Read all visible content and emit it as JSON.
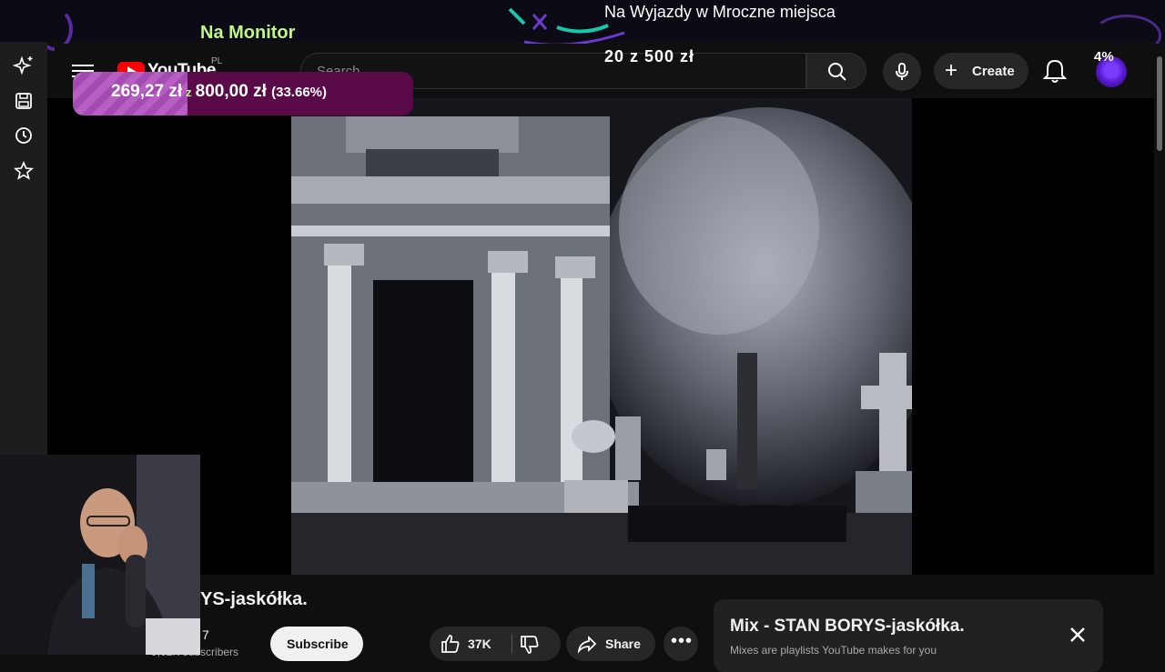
{
  "overlay": {
    "title": "Na Monitor",
    "goal_title": "Na Wyjazdy w Mroczne miejsca",
    "goal_amount": "20 z 500 zł",
    "goal_percent": "4%",
    "goal_fraction": 0.04
  },
  "donation": {
    "current": "269,27 zł",
    "separator": "z",
    "target": "800,00 zł",
    "percent": "(33.66%)",
    "progress": 0.3366,
    "fill_color": "#b85fc4",
    "track_color": "#5a0a48"
  },
  "header": {
    "logo_word": "YouTube",
    "country": "PL",
    "search_placeholder": "Search",
    "create_label": "Create"
  },
  "left_rail": {
    "icons": [
      "sparkle-icon",
      "save-icon",
      "history-icon",
      "star-icon"
    ]
  },
  "video": {
    "title": "YS-jaskółka.",
    "channel_count": "7",
    "subscribers": "9,02K subscribers",
    "subscribe_label": "Subscribe",
    "like_count": "37K",
    "share_label": "Share"
  },
  "mix": {
    "title": "Mix - STAN BORYS-jaskółka.",
    "subtitle": "Mixes are playlists YouTube makes for you"
  },
  "colors": {
    "accent_green": "#bff58d",
    "youtube_red": "#ff0000",
    "avatar_purple": "#7a3cff"
  }
}
